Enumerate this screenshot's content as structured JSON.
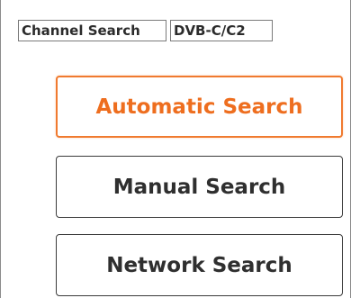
{
  "header": {
    "breadcrumb": [
      "Channel Search",
      "DVB-C/C2"
    ]
  },
  "menu": {
    "items": [
      {
        "label": "Automatic Search",
        "selected": true
      },
      {
        "label": "Manual Search",
        "selected": false
      },
      {
        "label": "Network Search",
        "selected": false
      }
    ]
  },
  "colors": {
    "accent": "#f07a2f",
    "text": "#2f2f2f",
    "border": "#3a3a3a",
    "background": "#ffffff"
  }
}
